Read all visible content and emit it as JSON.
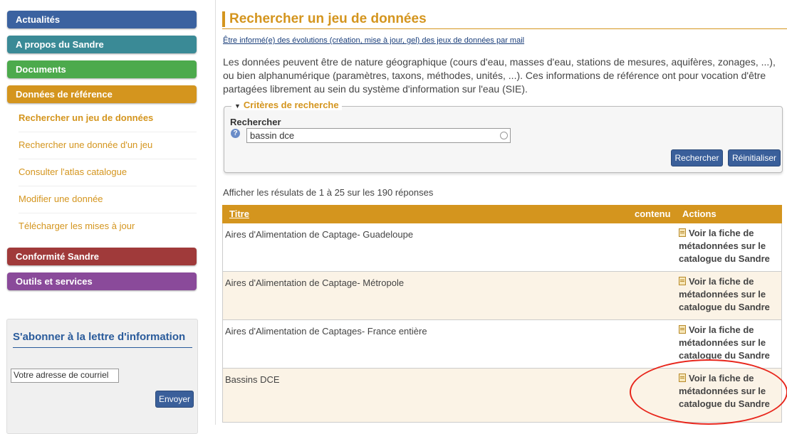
{
  "sidebar": {
    "nav": [
      {
        "label": "Actualités",
        "color": "#3b62a0"
      },
      {
        "label": "A propos du Sandre",
        "color": "#3a8a96"
      },
      {
        "label": "Documents",
        "color": "#4caa4c"
      },
      {
        "label": "Données de référence",
        "color": "#d4951e"
      },
      {
        "label": "Conformité Sandre",
        "color": "#a03a3a"
      },
      {
        "label": "Outils et services",
        "color": "#8a4a9a"
      }
    ],
    "subnav": [
      "Rechercher un jeu de données",
      "Rechercher une donnée d'un jeu",
      "Consulter l'atlas catalogue",
      "Modifier une donnée",
      "Télécharger les mises à jour"
    ],
    "newsletter": {
      "title": "S'abonner à la lettre d'information",
      "email_value": "Votre adresse de courriel",
      "send_label": "Envoyer"
    }
  },
  "main": {
    "title": "Rechercher un jeu de données",
    "notify_link": "Être informé(e) des évolutions (création, mise à jour, gel) des jeux de données par mail",
    "intro": "Les données peuvent être de nature géographique (cours d'eau, masses d'eau, stations de mesures, aquifères, zonages, ...), ou bien alphanumérique (paramètres, taxons, méthodes, unités, ...). Ces informations de référence ont pour vocation d'être partagées librement au sein du système d'information sur l'eau (SIE).",
    "criteria": {
      "legend": "Critères de recherche",
      "search_label": "Rechercher",
      "search_value": "bassin dce",
      "search_button": "Rechercher",
      "reset_button": "Réinitialiser"
    },
    "results_count": "Afficher les résulats de 1 à 25 sur les 190 réponses",
    "table": {
      "headers": {
        "title": "Titre",
        "contenu": "contenu",
        "actions": "Actions"
      },
      "action_label": "Voir la fiche de métadonnées sur le catalogue du Sandre",
      "rows": [
        "Aires d'Alimentation de Captage- Guadeloupe",
        "Aires d'Alimentation de Captage- Métropole",
        "Aires d'Alimentation de Captages- France entière",
        "Bassins DCE"
      ]
    }
  },
  "colors": {
    "accent": "#d4951e",
    "link": "#1a3e7a",
    "button": "#3a5f9a",
    "annotation": "#e8261c"
  }
}
